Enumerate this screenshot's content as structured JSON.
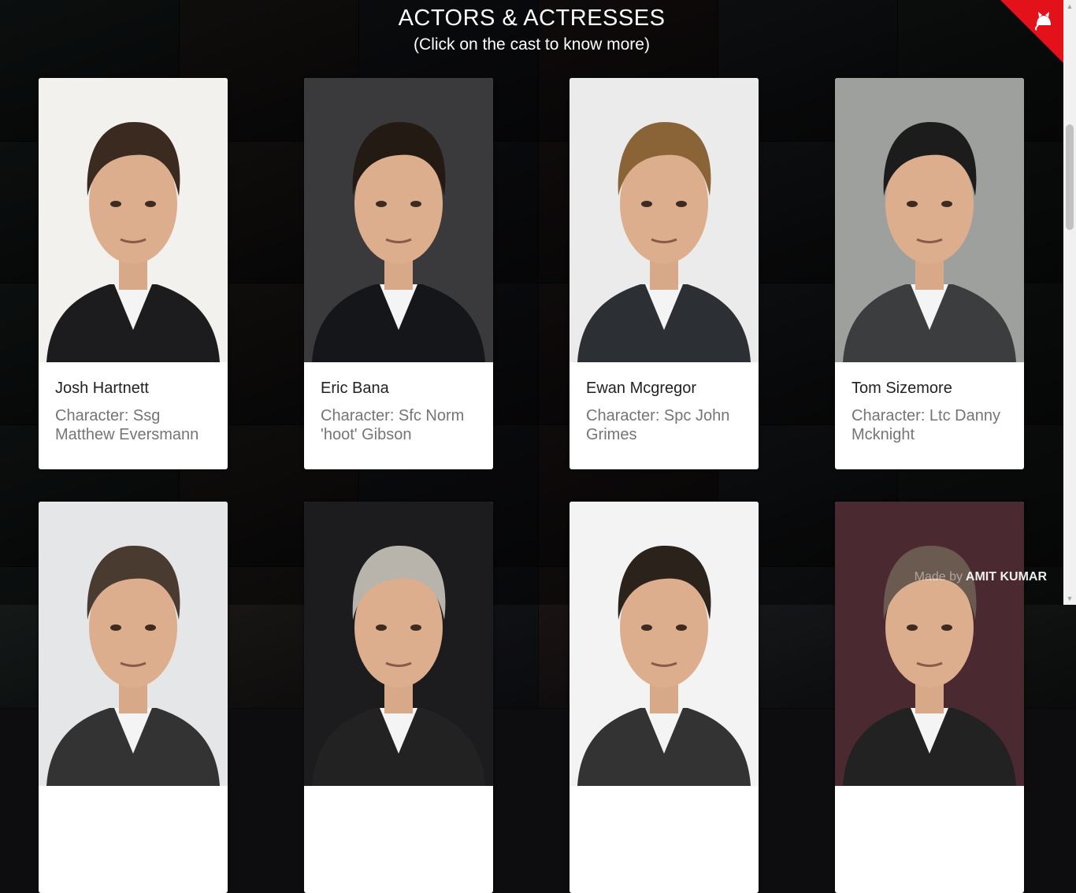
{
  "section": {
    "title": "ACTORS & ACTRESSES",
    "subtitle": "(Click on the cast to know more)"
  },
  "cast": [
    {
      "name": "Josh Hartnett",
      "character": "Character: Ssg Matthew Eversmann",
      "photo_bg": "#f2f1ee",
      "hair": "#3a2a20",
      "suit": "#1c1c1e"
    },
    {
      "name": "Eric Bana",
      "character": "Character: Sfc Norm 'hoot' Gibson",
      "photo_bg": "#3a3a3c",
      "hair": "#241a14",
      "suit": "#15161a"
    },
    {
      "name": "Ewan Mcgregor",
      "character": "Character: Spc John Grimes",
      "photo_bg": "#ecebec",
      "hair": "#8a6437",
      "suit": "#2c2f34"
    },
    {
      "name": "Tom Sizemore",
      "character": "Character: Ltc Danny Mcknight",
      "photo_bg": "#9ea09e",
      "hair": "#1c1c1c",
      "suit": "#3b3d3f"
    },
    {
      "name": "",
      "character": "",
      "photo_bg": "#e4e6e8",
      "hair": "#4a3b31",
      "suit": "#333"
    },
    {
      "name": "",
      "character": "",
      "photo_bg": "#1c1c1e",
      "hair": "#b8b3ab",
      "suit": "#222"
    },
    {
      "name": "",
      "character": "",
      "photo_bg": "#f3f3f3",
      "hair": "#2c221c",
      "suit": "#333"
    },
    {
      "name": "",
      "character": "",
      "photo_bg": "#4a2a30",
      "hair": "#6a5a50",
      "suit": "#222"
    }
  ],
  "credit": {
    "prefix": "Made by",
    "author": "AMIT KUMAR"
  },
  "colors": {
    "accent": "#e3121a",
    "card_bg": "#ffffff",
    "subtext": "#757575"
  },
  "icons": {
    "corner": "github-octocat-icon"
  }
}
